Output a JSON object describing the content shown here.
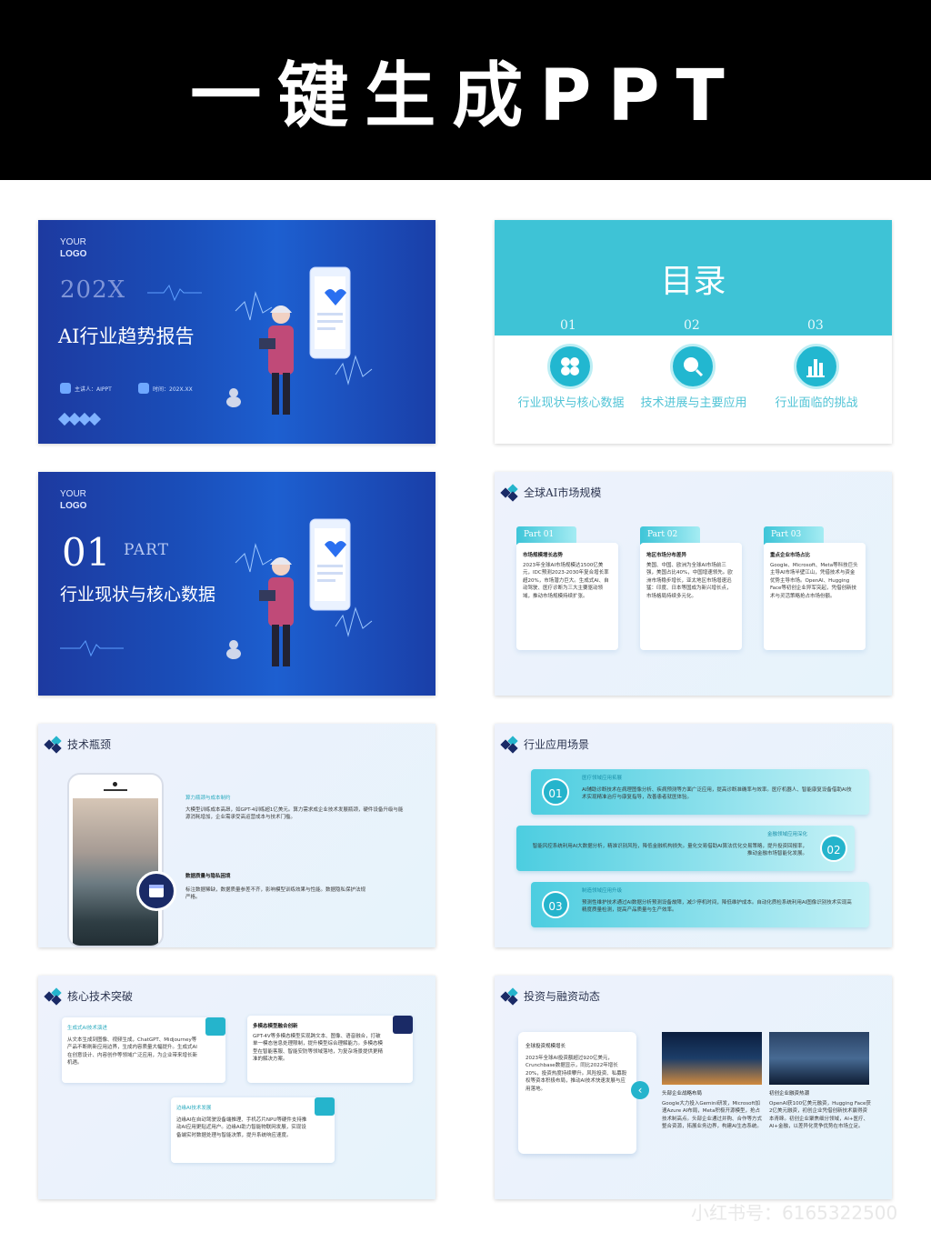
{
  "banner": {
    "title": "一键生成PPT"
  },
  "slide1": {
    "logo_line1": "YOUR",
    "logo_line2": "LOGO",
    "year": "202X",
    "title": "AI行业趋势报告",
    "presenter": "主讲人：AIPPT",
    "date": "时间：202X.XX"
  },
  "slide2": {
    "title": "目录",
    "items": [
      {
        "num": "01",
        "label": "行业现状与核心数据",
        "icon": "grid-icon"
      },
      {
        "num": "02",
        "label": "技术进展与主要应用",
        "icon": "search-icon"
      },
      {
        "num": "03",
        "label": "行业面临的挑战",
        "icon": "bar-chart-icon"
      }
    ]
  },
  "slide3": {
    "logo_line1": "YOUR",
    "logo_line2": "LOGO",
    "num": "01",
    "part": "PART",
    "title": "行业现状与核心数据"
  },
  "slide4": {
    "title": "全球AI市场规模",
    "cards": [
      {
        "tab": "Part 01",
        "heading": "市场规模增长态势",
        "body": "2023年全球AI市场规模达1500亿美元，IDC预测2023-2030年复合增长率超20%，市场潜力巨大。生成式AI、自动驾驶、医疗诊断为三大主要驱动领域，推动市场规模持续扩张。"
      },
      {
        "tab": "Part 02",
        "heading": "地区市场分布差异",
        "body": "美国、中国、欧洲为全球AI市场前三强，美国占比40%，中国增速领先。欧洲市场稳步增长，亚太地区市场增速迅猛：印度、日本等国成为新兴增长点，市场格局持续多元化。"
      },
      {
        "tab": "Part 03",
        "heading": "重点企业市场占比",
        "body": "Google、Microsoft、Meta等科技巨头主导AI市场半壁江山，凭借技术与资金优势主导市场。OpenAI、Hugging Face等初创企业异军突起，凭借创新技术与灵活策略抢占市场份额。"
      }
    ]
  },
  "slide5": {
    "title": "技术瓶颈",
    "block1_heading": "算力瓶颈与成本制约",
    "block1_body": "大模型训练成本高昂，如GPT-4训练超1亿美元。算力需求成企业技术发展瓶颈，硬件设备升级与能源消耗增加，企业需承受高运营成本与技术门槛。",
    "block2_heading": "数据质量与隐私困境",
    "block2_body": "标注数据稀缺，数据质量参差不齐，影响模型训练效果与性能。数据隐私保护法规严格。"
  },
  "slide6": {
    "title": "行业应用场景",
    "items": [
      {
        "num": "01",
        "heading": "医疗领域应用拓展",
        "body": "AI辅助诊断技术在病理图像分析、疾病预测等方面广泛应用，提高诊断准确率与效率。医疗机器人、智能康复设备借助AI技术实现精准治疗与康复指导，改善患者就医体验。"
      },
      {
        "num": "02",
        "heading": "金融领域应用深化",
        "body": "智能风控系统利用AI大数据分析，精准识别风险，降低金融机构损失。量化交易借助AI算法优化交易策略，提升投资回报率，推动金融市场智能化发展。"
      },
      {
        "num": "03",
        "heading": "制造领域应用升级",
        "body": "预测性维护技术通过AI数据分析预测设备故障，减少停机时间，降低维护成本。自动化质检系统利用AI图像识别技术实现高精度质量检测，提高产品质量与生产效率。"
      }
    ]
  },
  "slide7": {
    "title": "核心技术突破",
    "boxes": [
      {
        "heading": "生成式AI技术演进",
        "body": "从文本生成到图像、视频生成，ChatGPT、Midjourney等产品不断刷新应用边界，生成内容质量大幅提升。生成式AI在创意设计、内容创作等领域广泛应用，为企业带来增长新机遇。"
      },
      {
        "heading": "多模态模型融合创新",
        "body": "GPT-4V等多模态模型实现跨文本、图像、语音融合，打破单一模态信息处理限制，提升模型综合理解能力。多模态模型在智能客服、智能安防等领域落地，为复杂场景提供更精准的解决方案。"
      },
      {
        "heading": "边缘AI技术发展",
        "body": "边缘AI在自动驾驶设备端推理、手机芯片NPU等硬件支持推动AI应用更贴近用户。边缘AI助力智能物联网发展，实现设备端实时数据处理与智能决策，提升系统响应速度。"
      }
    ]
  },
  "slide8": {
    "title": "投资与融资动态",
    "card_heading": "全球投资规模增长",
    "card_body": "2023年全球AI投资额超过920亿美元，Crunchbase数据显示，同比2022年增长20%，投资热度持续攀升。风险投资、私募股权等资本积极布局，推动AI技术快速发展与应用落地。",
    "col1_heading": "头部企业战略布局",
    "col1_body": "Google大力投入Gemini研发，Microsoft加速Azure AI布局，Meta积极开源模型，抢占技术制高点。头部企业通过并购、合作等方式整合资源，拓展业务边界，构建AI生态系统。",
    "col2_heading": "初创企业融资热潮",
    "col2_body": "OpenAI获100亿美元融资，Hugging Face获2亿美元融资，初创企业凭借创新技术赢得资本青睐。初创企业聚焦细分领域，AI+医疗、AI+金融，以差异化竞争优势在市场立足。"
  },
  "watermark": "小红书号：6165322500"
}
